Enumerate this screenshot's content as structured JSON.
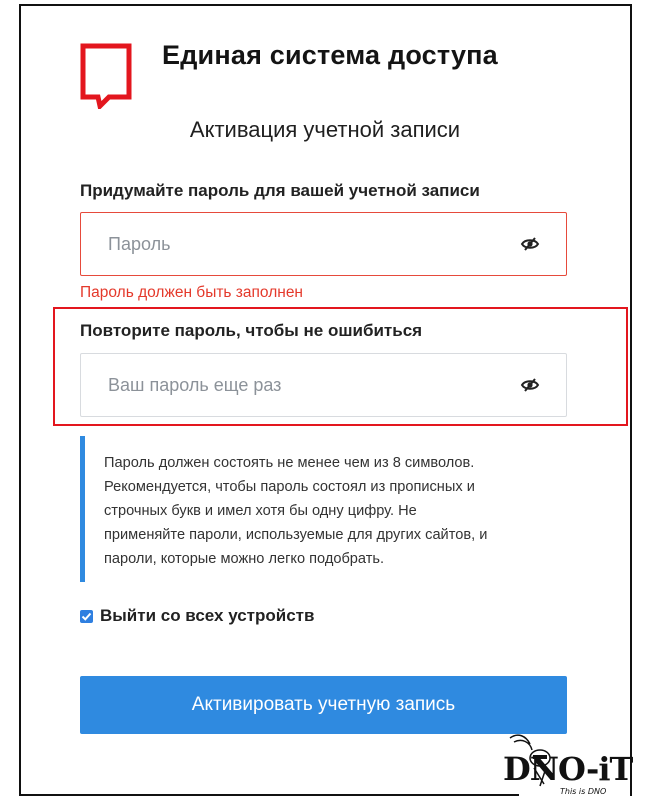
{
  "header": {
    "brand_title": "Единая система доступа",
    "page_title": "Активация учетной записи"
  },
  "form": {
    "password": {
      "label": "Придумайте пароль для вашей учетной записи",
      "placeholder": "Пароль",
      "value": "",
      "error": "Пароль должен быть заполнен"
    },
    "confirm": {
      "label": "Повторите пароль, чтобы не ошибиться",
      "placeholder": "Ваш пароль еще раз",
      "value": ""
    },
    "hint_lines": [
      "Пароль должен состоять не менее чем из 8 символов.",
      "Рекомендуется, чтобы пароль состоял из прописных и",
      "строчных букв и имел хотя бы одну цифру. Не",
      "применяйте пароли, используемые для других сайтов, и",
      "пароли, которые можно легко подобрать."
    ],
    "logout_all": {
      "label": "Выйти со всех устройств",
      "checked": true
    },
    "submit_label": "Активировать учетную запись"
  },
  "watermark": {
    "text": "DNO-iT",
    "subtext": "This is DNO"
  },
  "colors": {
    "accent": "#2f8ae0",
    "error": "#e4392b",
    "logo_red": "#e3161e",
    "highlight": "#e3161e"
  },
  "icons": {
    "logo": "speech-bubble-logo",
    "password_eye": "eye-slash-icon",
    "confirm_eye": "eye-slash-icon",
    "checkbox_check": "checkmark-icon"
  }
}
